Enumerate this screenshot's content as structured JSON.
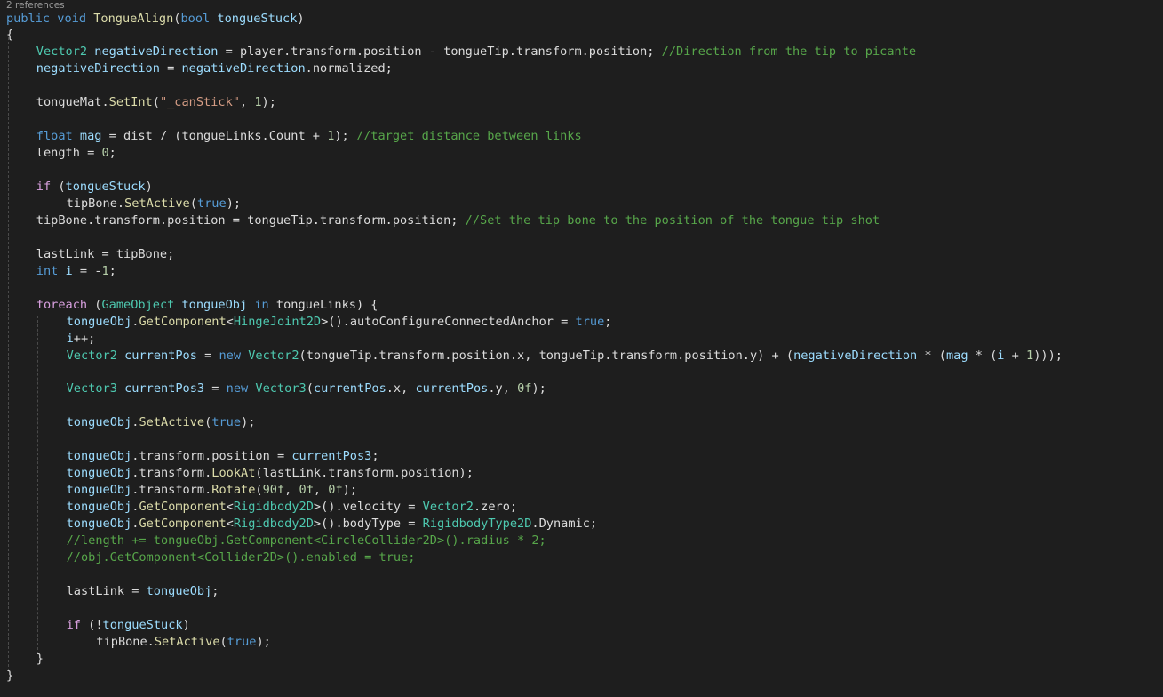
{
  "codelens": "2 references",
  "lines": [
    {
      "indent": 0,
      "tokens": [
        [
          "kw",
          "public"
        ],
        [
          "p",
          " "
        ],
        [
          "kw",
          "void"
        ],
        [
          "p",
          " "
        ],
        [
          "m",
          "TongueAlign"
        ],
        [
          "p",
          "("
        ],
        [
          "kw",
          "bool"
        ],
        [
          "p",
          " "
        ],
        [
          "v",
          "tongueStuck"
        ],
        [
          "p",
          ")"
        ]
      ]
    },
    {
      "indent": 0,
      "tokens": [
        [
          "p",
          "{"
        ]
      ]
    },
    {
      "indent": 1,
      "tokens": [
        [
          "t",
          "Vector2"
        ],
        [
          "p",
          " "
        ],
        [
          "v",
          "negativeDirection"
        ],
        [
          "p",
          " = player.transform.position - tongueTip.transform.position; "
        ],
        [
          "c",
          "//Direction from the tip to picante"
        ]
      ]
    },
    {
      "indent": 1,
      "tokens": [
        [
          "v",
          "negativeDirection"
        ],
        [
          "p",
          " = "
        ],
        [
          "v",
          "negativeDirection"
        ],
        [
          "p",
          ".normalized;"
        ]
      ]
    },
    {
      "indent": 1,
      "tokens": []
    },
    {
      "indent": 1,
      "tokens": [
        [
          "p",
          "tongueMat."
        ],
        [
          "m",
          "SetInt"
        ],
        [
          "p",
          "("
        ],
        [
          "s",
          "\"_canStick\""
        ],
        [
          "p",
          ", "
        ],
        [
          "n",
          "1"
        ],
        [
          "p",
          ");"
        ]
      ]
    },
    {
      "indent": 1,
      "tokens": []
    },
    {
      "indent": 1,
      "tokens": [
        [
          "kw",
          "float"
        ],
        [
          "p",
          " "
        ],
        [
          "v",
          "mag"
        ],
        [
          "p",
          " = dist / (tongueLinks.Count + "
        ],
        [
          "n",
          "1"
        ],
        [
          "p",
          "); "
        ],
        [
          "c",
          "//target distance between links"
        ]
      ]
    },
    {
      "indent": 1,
      "tokens": [
        [
          "p",
          "length = "
        ],
        [
          "n",
          "0"
        ],
        [
          "p",
          ";"
        ]
      ]
    },
    {
      "indent": 1,
      "tokens": []
    },
    {
      "indent": 1,
      "tokens": [
        [
          "ctl",
          "if"
        ],
        [
          "p",
          " ("
        ],
        [
          "v",
          "tongueStuck"
        ],
        [
          "p",
          ")"
        ]
      ]
    },
    {
      "indent": 2,
      "tokens": [
        [
          "p",
          "tipBone."
        ],
        [
          "m",
          "SetActive"
        ],
        [
          "p",
          "("
        ],
        [
          "kw",
          "true"
        ],
        [
          "p",
          ");"
        ]
      ]
    },
    {
      "indent": 1,
      "tokens": [
        [
          "p",
          "tipBone.transform.position = tongueTip.transform.position; "
        ],
        [
          "c",
          "//Set the tip bone to the position of the tongue tip shot"
        ]
      ]
    },
    {
      "indent": 1,
      "tokens": []
    },
    {
      "indent": 1,
      "tokens": [
        [
          "p",
          "lastLink = tipBone;"
        ]
      ]
    },
    {
      "indent": 1,
      "tokens": [
        [
          "kw",
          "int"
        ],
        [
          "p",
          " "
        ],
        [
          "v",
          "i"
        ],
        [
          "p",
          " = -"
        ],
        [
          "n",
          "1"
        ],
        [
          "p",
          ";"
        ]
      ]
    },
    {
      "indent": 1,
      "tokens": []
    },
    {
      "indent": 1,
      "tokens": [
        [
          "ctl",
          "foreach"
        ],
        [
          "p",
          " ("
        ],
        [
          "t",
          "GameObject"
        ],
        [
          "p",
          " "
        ],
        [
          "v",
          "tongueObj"
        ],
        [
          "p",
          " "
        ],
        [
          "kw",
          "in"
        ],
        [
          "p",
          " tongueLinks) {"
        ]
      ]
    },
    {
      "indent": 2,
      "tokens": [
        [
          "v",
          "tongueObj"
        ],
        [
          "p",
          "."
        ],
        [
          "m",
          "GetComponent"
        ],
        [
          "p",
          "<"
        ],
        [
          "t",
          "HingeJoint2D"
        ],
        [
          "p",
          ">()."
        ],
        [
          "p",
          "autoConfigureConnectedAnchor = "
        ],
        [
          "kw",
          "true"
        ],
        [
          "p",
          ";"
        ]
      ]
    },
    {
      "indent": 2,
      "tokens": [
        [
          "v",
          "i"
        ],
        [
          "p",
          "++;"
        ]
      ]
    },
    {
      "indent": 2,
      "tokens": [
        [
          "t",
          "Vector2"
        ],
        [
          "p",
          " "
        ],
        [
          "v",
          "currentPos"
        ],
        [
          "p",
          " = "
        ],
        [
          "kw",
          "new"
        ],
        [
          "p",
          " "
        ],
        [
          "t",
          "Vector2"
        ],
        [
          "p",
          "(tongueTip.transform.position.x, tongueTip.transform.position.y) + ("
        ],
        [
          "v",
          "negativeDirection"
        ],
        [
          "p",
          " * ("
        ],
        [
          "v",
          "mag"
        ],
        [
          "p",
          " * ("
        ],
        [
          "v",
          "i"
        ],
        [
          "p",
          " + "
        ],
        [
          "n",
          "1"
        ],
        [
          "p",
          ")));"
        ]
      ]
    },
    {
      "indent": 2,
      "tokens": []
    },
    {
      "indent": 2,
      "tokens": [
        [
          "t",
          "Vector3"
        ],
        [
          "p",
          " "
        ],
        [
          "v",
          "currentPos3"
        ],
        [
          "p",
          " = "
        ],
        [
          "kw",
          "new"
        ],
        [
          "p",
          " "
        ],
        [
          "t",
          "Vector3"
        ],
        [
          "p",
          "("
        ],
        [
          "v",
          "currentPos"
        ],
        [
          "p",
          ".x, "
        ],
        [
          "v",
          "currentPos"
        ],
        [
          "p",
          ".y, "
        ],
        [
          "n",
          "0f"
        ],
        [
          "p",
          ");"
        ]
      ]
    },
    {
      "indent": 2,
      "tokens": []
    },
    {
      "indent": 2,
      "tokens": [
        [
          "v",
          "tongueObj"
        ],
        [
          "p",
          "."
        ],
        [
          "m",
          "SetActive"
        ],
        [
          "p",
          "("
        ],
        [
          "kw",
          "true"
        ],
        [
          "p",
          ");"
        ]
      ]
    },
    {
      "indent": 2,
      "tokens": []
    },
    {
      "indent": 2,
      "tokens": [
        [
          "v",
          "tongueObj"
        ],
        [
          "p",
          ".transform.position = "
        ],
        [
          "v",
          "currentPos3"
        ],
        [
          "p",
          ";"
        ]
      ]
    },
    {
      "indent": 2,
      "tokens": [
        [
          "v",
          "tongueObj"
        ],
        [
          "p",
          ".transform."
        ],
        [
          "m",
          "LookAt"
        ],
        [
          "p",
          "(lastLink.transform.position);"
        ]
      ]
    },
    {
      "indent": 2,
      "tokens": [
        [
          "v",
          "tongueObj"
        ],
        [
          "p",
          ".transform."
        ],
        [
          "m",
          "Rotate"
        ],
        [
          "p",
          "("
        ],
        [
          "n",
          "90f"
        ],
        [
          "p",
          ", "
        ],
        [
          "n",
          "0f"
        ],
        [
          "p",
          ", "
        ],
        [
          "n",
          "0f"
        ],
        [
          "p",
          ");"
        ]
      ]
    },
    {
      "indent": 2,
      "tokens": [
        [
          "v",
          "tongueObj"
        ],
        [
          "p",
          "."
        ],
        [
          "m",
          "GetComponent"
        ],
        [
          "p",
          "<"
        ],
        [
          "t",
          "Rigidbody2D"
        ],
        [
          "p",
          ">().velocity = "
        ],
        [
          "t",
          "Vector2"
        ],
        [
          "p",
          ".zero;"
        ]
      ]
    },
    {
      "indent": 2,
      "tokens": [
        [
          "v",
          "tongueObj"
        ],
        [
          "p",
          "."
        ],
        [
          "m",
          "GetComponent"
        ],
        [
          "p",
          "<"
        ],
        [
          "t",
          "Rigidbody2D"
        ],
        [
          "p",
          ">().bodyType = "
        ],
        [
          "t",
          "RigidbodyType2D"
        ],
        [
          "p",
          ".Dynamic;"
        ]
      ]
    },
    {
      "indent": 2,
      "tokens": [
        [
          "c",
          "//length += tongueObj.GetComponent<CircleCollider2D>().radius * 2;"
        ]
      ]
    },
    {
      "indent": 2,
      "tokens": [
        [
          "c",
          "//obj.GetComponent<Collider2D>().enabled = true;"
        ]
      ]
    },
    {
      "indent": 2,
      "tokens": []
    },
    {
      "indent": 2,
      "tokens": [
        [
          "p",
          "lastLink = "
        ],
        [
          "v",
          "tongueObj"
        ],
        [
          "p",
          ";"
        ]
      ]
    },
    {
      "indent": 2,
      "tokens": []
    },
    {
      "indent": 2,
      "tokens": [
        [
          "ctl",
          "if"
        ],
        [
          "p",
          " (!"
        ],
        [
          "v",
          "tongueStuck"
        ],
        [
          "p",
          ")"
        ]
      ]
    },
    {
      "indent": 3,
      "tokens": [
        [
          "p",
          "tipBone."
        ],
        [
          "m",
          "SetActive"
        ],
        [
          "p",
          "("
        ],
        [
          "kw",
          "true"
        ],
        [
          "p",
          ");"
        ]
      ]
    },
    {
      "indent": 1,
      "tokens": [
        [
          "p",
          "}"
        ]
      ]
    },
    {
      "indent": 0,
      "tokens": [
        [
          "p",
          "}"
        ]
      ]
    }
  ]
}
